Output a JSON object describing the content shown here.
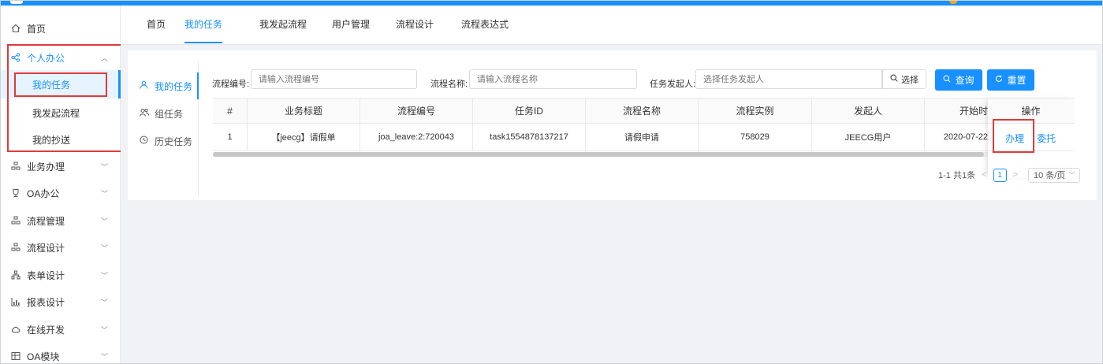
{
  "colors": {
    "primary": "#1890ff",
    "highlight": "#e03a3a",
    "background": "#f0f2f5"
  },
  "sidebar": {
    "items": [
      {
        "label": "首页",
        "icon": "home-icon"
      },
      {
        "label": "个人办公",
        "icon": "share-icon",
        "expanded": true
      },
      {
        "label": "业务办理",
        "icon": "grid-icon"
      },
      {
        "label": "OA办公",
        "icon": "trophy-icon"
      },
      {
        "label": "流程管理",
        "icon": "grid-icon"
      },
      {
        "label": "流程设计",
        "icon": "grid-icon"
      },
      {
        "label": "表单设计",
        "icon": "cluster-icon"
      },
      {
        "label": "报表设计",
        "icon": "bar-chart-icon"
      },
      {
        "label": "在线开发",
        "icon": "cloud-icon"
      },
      {
        "label": "OA模块",
        "icon": "table-icon"
      }
    ],
    "sub_items": [
      {
        "label": "我的任务",
        "selected": true
      },
      {
        "label": "我发起流程"
      },
      {
        "label": "我的抄送"
      }
    ]
  },
  "tabs": [
    "首页",
    "我的任务",
    "我发起流程",
    "用户管理",
    "流程设计",
    "流程表达式"
  ],
  "active_tab": "我的任务",
  "vtabs": [
    "我的任务",
    "组任务",
    "历史任务"
  ],
  "filters": {
    "process_no_label": "流程编号:",
    "process_no_placeholder": "请输入流程编号",
    "process_name_label": "流程名称:",
    "process_name_placeholder": "请输入流程名称",
    "initiator_label": "任务发起人:",
    "initiator_placeholder": "选择任务发起人",
    "select_label": "选择",
    "query_label": "查询",
    "reset_label": "重置"
  },
  "table": {
    "columns": [
      "#",
      "业务标题",
      "流程编号",
      "任务ID",
      "流程名称",
      "流程实例",
      "发起人",
      "开始时",
      "操作"
    ],
    "rows": [
      {
        "index": "1",
        "title": "【jeecg】请假单",
        "process_no": "joa_leave:2:720043",
        "task_id": "task1554878137217",
        "process_name": "请假申请",
        "instance": "758029",
        "initiator": "JEECG用户",
        "start": "2020-07-22"
      }
    ],
    "actions": {
      "handle": "办理",
      "delegate": "委托"
    }
  },
  "pagination": {
    "summary": "1-1 共1条",
    "current_page": "1",
    "page_size": "10 条/页"
  }
}
